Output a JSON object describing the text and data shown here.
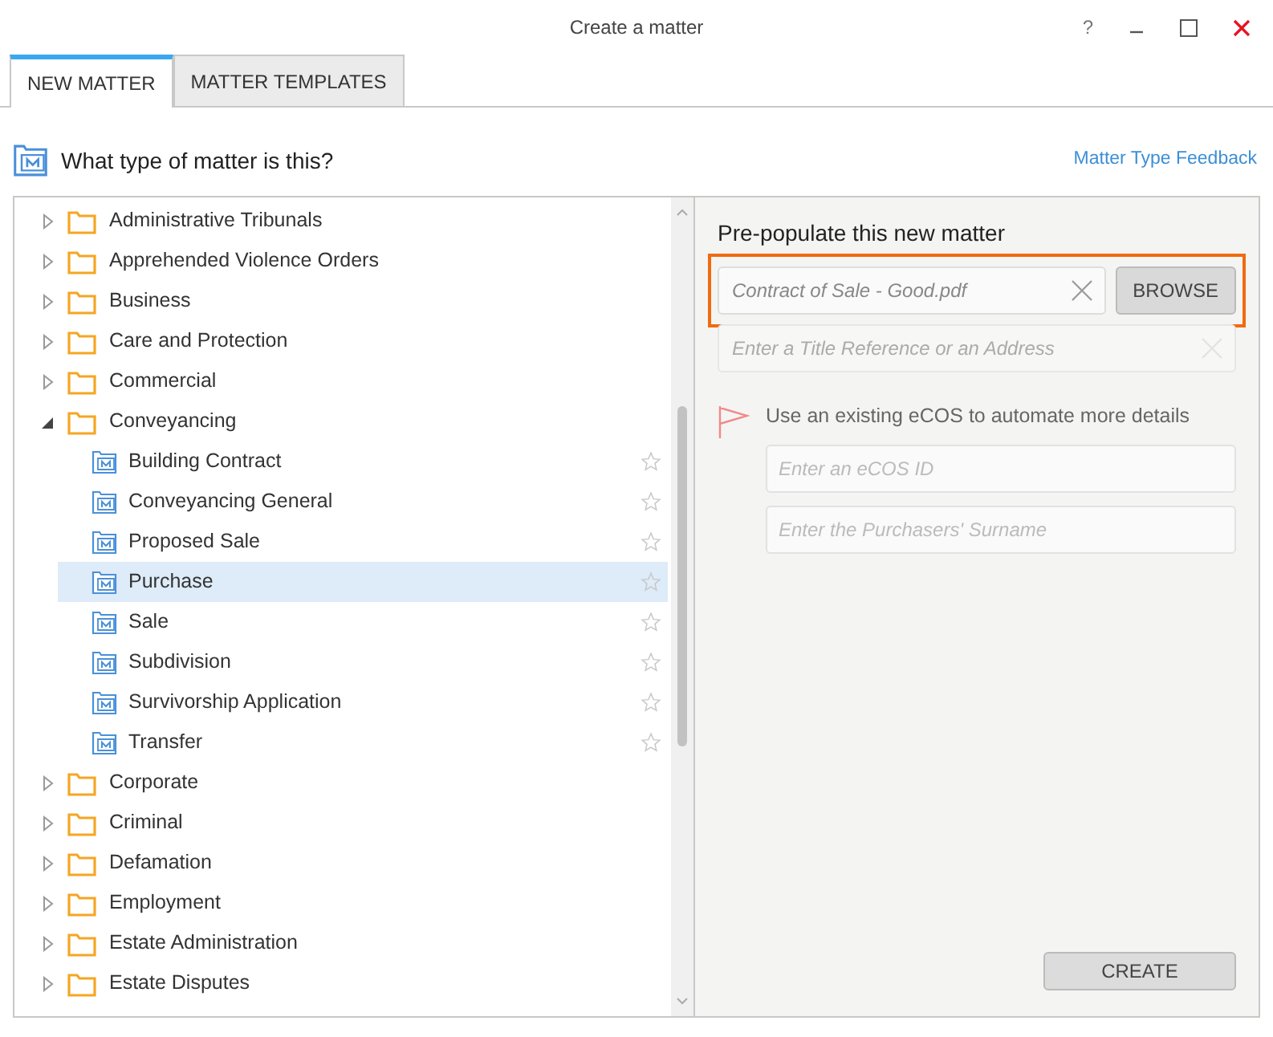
{
  "window": {
    "title": "Create a matter",
    "help": "?"
  },
  "tabs": [
    {
      "label": "NEW MATTER",
      "selected": true
    },
    {
      "label": "MATTER TEMPLATES",
      "selected": false
    }
  ],
  "header": {
    "question": "What type of matter is this?",
    "feedback_link": "Matter Type Feedback"
  },
  "tree": [
    {
      "label": "Administrative Tribunals",
      "expanded": false
    },
    {
      "label": "Apprehended Violence Orders",
      "expanded": false
    },
    {
      "label": "Business",
      "expanded": false
    },
    {
      "label": "Care and Protection",
      "expanded": false
    },
    {
      "label": "Commercial",
      "expanded": false
    },
    {
      "label": "Conveyancing",
      "expanded": true,
      "children": [
        {
          "label": "Building Contract",
          "selected": false,
          "starred": false
        },
        {
          "label": "Conveyancing General",
          "selected": false,
          "starred": false
        },
        {
          "label": "Proposed Sale",
          "selected": false,
          "starred": false
        },
        {
          "label": "Purchase",
          "selected": true,
          "starred": false
        },
        {
          "label": "Sale",
          "selected": false,
          "starred": false
        },
        {
          "label": "Subdivision",
          "selected": false,
          "starred": false
        },
        {
          "label": "Survivorship Application",
          "selected": false,
          "starred": false
        },
        {
          "label": "Transfer",
          "selected": false,
          "starred": false
        }
      ]
    },
    {
      "label": "Corporate",
      "expanded": false
    },
    {
      "label": "Criminal",
      "expanded": false
    },
    {
      "label": "Defamation",
      "expanded": false
    },
    {
      "label": "Employment",
      "expanded": false
    },
    {
      "label": "Estate Administration",
      "expanded": false
    },
    {
      "label": "Estate Disputes",
      "expanded": false
    }
  ],
  "prepopulate": {
    "title": "Pre-populate this new matter",
    "file_field": {
      "value": "Contract of Sale - Good.pdf",
      "highlighted": true
    },
    "browse_button": "BROWSE",
    "title_reference_field": {
      "placeholder": "Enter a Title Reference or an Address"
    },
    "ecos": {
      "label": "Use an existing eCOS to automate more details",
      "id_field": {
        "placeholder": "Enter an eCOS ID"
      },
      "surname_field": {
        "placeholder": "Enter the Purchasers' Surname"
      }
    }
  },
  "create_button": "CREATE"
}
